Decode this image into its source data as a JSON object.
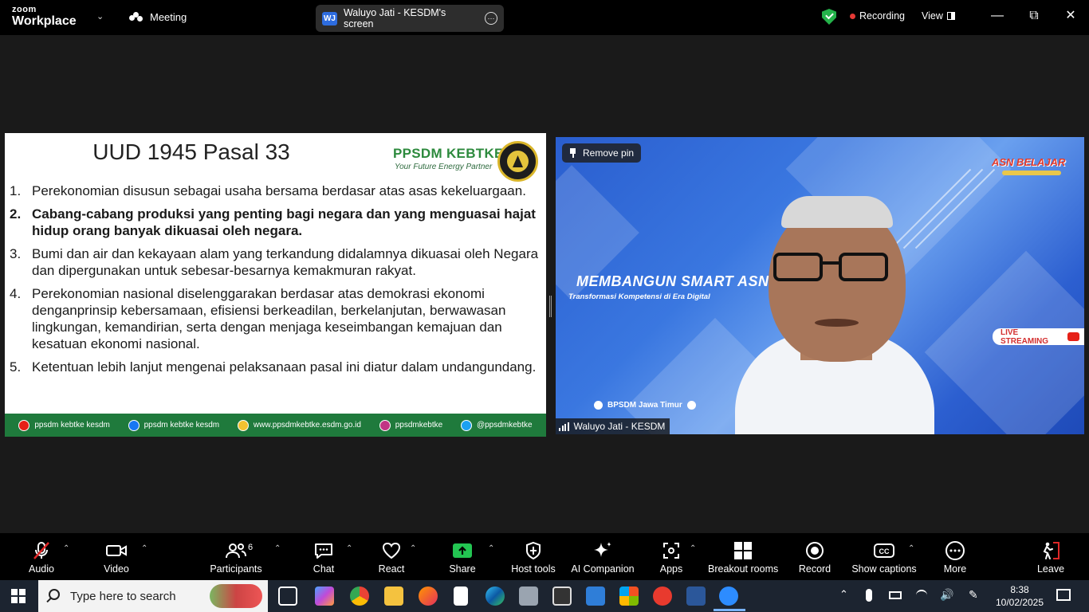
{
  "titlebar": {
    "brand_top": "zoom",
    "brand_bottom": "Workplace",
    "meeting_label": "Meeting",
    "share_initials": "WJ",
    "share_label": "Waluyo Jati - KESDM's screen",
    "recording_label": "Recording",
    "view_label": "View",
    "colors": {
      "recording_dot": "#e53935",
      "shield": "#24b24a"
    }
  },
  "slide": {
    "title": "UUD 1945 Pasal 33",
    "logo_name": "PPSDM KEBTKE",
    "logo_tagline": "Your Future Energy Partner",
    "items": [
      {
        "num": "1.",
        "text": "Perekonomian disusun sebagai usaha bersama berdasar atas asas kekeluargaan.",
        "bold": false
      },
      {
        "num": "2.",
        "text": "Cabang-cabang produksi yang penting bagi negara dan yang menguasai hajat hidup orang banyak dikuasai oleh negara.",
        "bold": true
      },
      {
        "num": "3.",
        "text": "Bumi dan air dan kekayaan alam yang terkandung didalamnya dikuasai oleh Negara dan dipergunakan untuk sebesar-besarnya kemakmuran rakyat.",
        "bold": false
      },
      {
        "num": "4.",
        "text": "Perekonomian nasional diselenggarakan berdasar atas demokrasi ekonomi denganprinsip kebersamaan, efisiensi berkeadilan, berkelanjutan, berwawasan lingkungan, kemandirian, serta dengan menjaga keseimbangan kemajuan dan kesatuan ekonomi nasional.",
        "bold": false
      },
      {
        "num": "5.",
        "text": "Ketentuan lebih lanjut mengenai pelaksanaan pasal ini diatur dalam undangundang.",
        "bold": false
      }
    ],
    "social": [
      {
        "icon": "youtube-icon",
        "text": "ppsdm kebtke kesdm",
        "color": "#e62117"
      },
      {
        "icon": "facebook-icon",
        "text": "ppsdm kebtke kesdm",
        "color": "#1877f2"
      },
      {
        "icon": "web-icon",
        "text": "www.ppsdmkebtke.esdm.go.id",
        "color": "#f2c230"
      },
      {
        "icon": "instagram-icon",
        "text": "ppsdmkebtke",
        "color": "#c13584"
      },
      {
        "icon": "twitter-icon",
        "text": "@ppsdmkebtke",
        "color": "#1da1f2"
      }
    ]
  },
  "video": {
    "remove_pin": "Remove pin",
    "asn_logo": "ASN BELAJAR",
    "headline": "MEMBANGUN SMART ASN",
    "subheadline": "Transformasi Kompetensi di Era Digital",
    "live_label": "LIVE STREAMING",
    "bpsdm_label": "BPSDM Jawa Timur",
    "participant_name": "Waluyo Jati - KESDM"
  },
  "toolbar": {
    "audio": "Audio",
    "video": "Video",
    "participants": "Participants",
    "participants_count": "6",
    "chat": "Chat",
    "react": "React",
    "share": "Share",
    "host_tools": "Host tools",
    "ai_companion": "AI Companion",
    "apps": "Apps",
    "breakout": "Breakout rooms",
    "record": "Record",
    "captions": "Show captions",
    "more": "More",
    "leave": "Leave",
    "colors": {
      "share_green": "#23c552",
      "mute_red": "#e02828",
      "leave_red": "#e02828"
    }
  },
  "taskbar": {
    "search_placeholder": "Type here to search",
    "time": "8:38",
    "date": "10/02/2025"
  }
}
